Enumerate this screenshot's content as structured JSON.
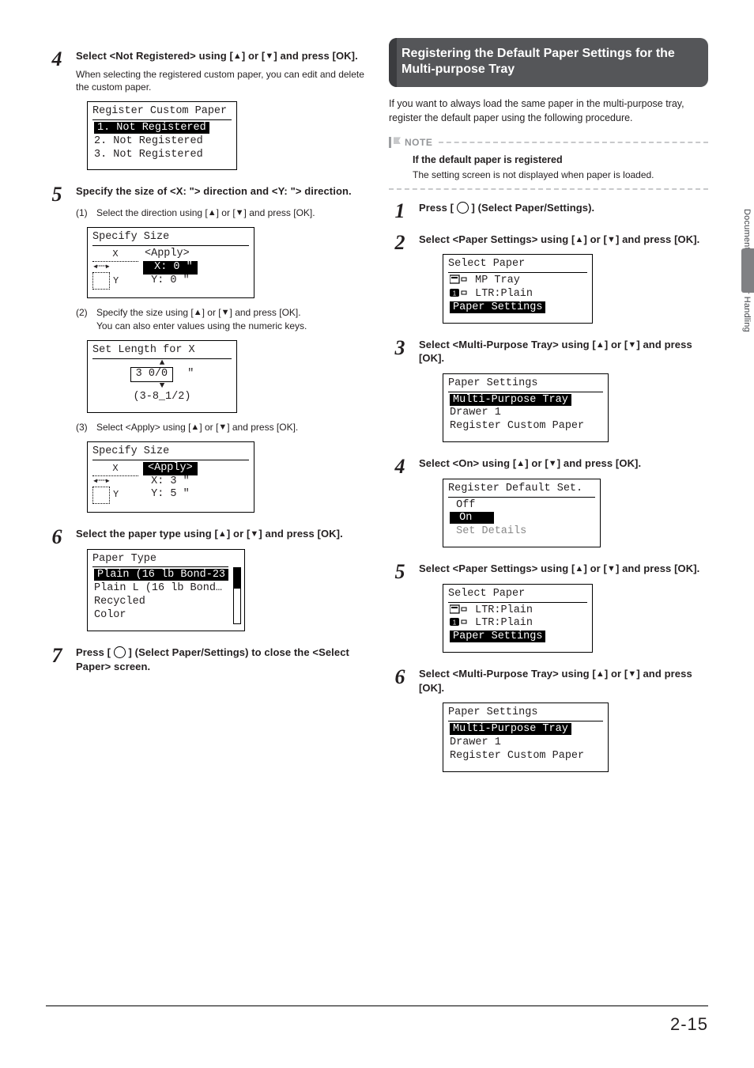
{
  "sideTab": {
    "label": "Document and Paper Handling"
  },
  "pageNumber": "2-15",
  "left": {
    "step4": {
      "title_a": "Select <Not Registered> using [",
      "title_b": "] or [",
      "title_c": "] and press [OK].",
      "sub": "When selecting the registered custom paper, you can edit and delete the custom paper.",
      "lcd": {
        "title": "Register Custom Paper",
        "rows": [
          "1. Not Registered",
          "2. Not Registered",
          "3. Not Registered"
        ]
      }
    },
    "step5": {
      "title": "Specify the size of <X: \"> direction and <Y: \"> direction.",
      "s1_a": "Select the direction using [",
      "s1_b": "] or [",
      "s1_c": "] and press [OK].",
      "lcd1": {
        "title": "Specify Size",
        "apply": "<Apply>",
        "x": " X: 0 \"",
        "y": " Y: 0 \""
      },
      "s2_a": "Specify the size using [",
      "s2_b": "] or [",
      "s2_c": "] and press [OK].",
      "s2_extra": "You can also enter values using the numeric keys.",
      "lcd2": {
        "title": "Set Length for X",
        "entry": "3 0/0",
        "unit": "\"",
        "range": "(3-8_1/2)"
      },
      "s3_a": "Select <Apply> using [",
      "s3_b": "] or [",
      "s3_c": "] and press [OK].",
      "lcd3": {
        "title": "Specify Size",
        "apply": "<Apply>",
        "x": " X: 3 \"",
        "y": " Y: 5 \""
      }
    },
    "step6": {
      "title_a": "Select the paper type using [",
      "title_b": "] or [",
      "title_c": "] and press [OK].",
      "lcd": {
        "title": "Paper Type",
        "rows": [
          "Plain (16 lb Bond-23",
          "Plain L (16 lb Bond…",
          "Recycled",
          "Color"
        ]
      }
    },
    "step7": {
      "title_a": "Press [ ",
      "title_b": " ] (Select Paper/Settings) to close the <Select Paper> screen."
    }
  },
  "right": {
    "sectionTitle": "Registering the Default Paper Settings for the Multi-purpose Tray",
    "intro": "If you want to always load the same paper in the multi-purpose tray, register the default paper using the following procedure.",
    "noteLabel": "NOTE",
    "noteTitle": "If the default paper is registered",
    "noteDesc": "The setting screen is not displayed when paper is loaded.",
    "step1": {
      "title_a": "Press [ ",
      "title_b": " ] (Select Paper/Settings)."
    },
    "step2": {
      "title_a": "Select <Paper Settings> using [",
      "title_b": "] or [",
      "title_c": "] and press [OK].",
      "lcd": {
        "title": "Select Paper",
        "rows": [
          " MP Tray",
          " LTR:Plain",
          "Paper Settings"
        ]
      }
    },
    "step3": {
      "title_a": "Select <Multi-Purpose Tray> using [",
      "title_b": "] or [",
      "title_c": "] and press [OK].",
      "lcd": {
        "title": "Paper Settings",
        "rows": [
          "Multi-Purpose Tray",
          "Drawer 1",
          "Register Custom Paper"
        ]
      }
    },
    "step4": {
      "title_a": "Select <On> using [",
      "title_b": "] or [",
      "title_c": "] and press [OK].",
      "lcd": {
        "title": "Register Default Set.",
        "rows": [
          " Off",
          " On",
          " Set Details"
        ]
      }
    },
    "step5": {
      "title_a": "Select <Paper Settings> using [",
      "title_b": "] or [",
      "title_c": "] and press [OK].",
      "lcd": {
        "title": "Select Paper",
        "rows": [
          " LTR:Plain",
          " LTR:Plain",
          "Paper Settings"
        ]
      }
    },
    "step6": {
      "title_a": "Select <Multi-Purpose Tray> using [",
      "title_b": "] or [",
      "title_c": "] and press [OK].",
      "lcd": {
        "title": "Paper Settings",
        "rows": [
          "Multi-Purpose Tray",
          "Drawer 1",
          "Register Custom Paper"
        ]
      }
    }
  }
}
